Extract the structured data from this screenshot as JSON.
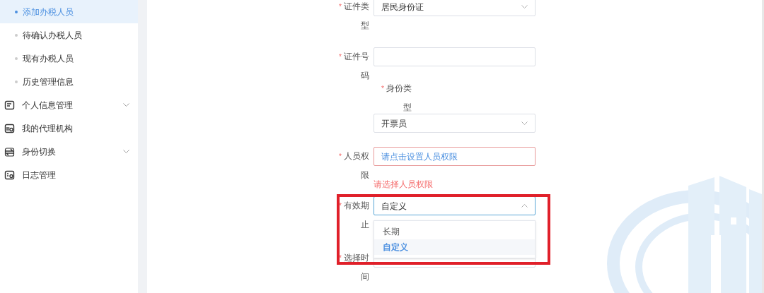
{
  "sidebar": {
    "sub_items": [
      {
        "label": "添加办税人员",
        "selected": true
      },
      {
        "label": "待确认办税人员",
        "selected": false
      },
      {
        "label": "现有办税人员",
        "selected": false
      },
      {
        "label": "历史管理信息",
        "selected": false
      }
    ],
    "menu": [
      {
        "label": "个人信息管理",
        "kind": "list",
        "expandable": true
      },
      {
        "label": "我的代理机构",
        "kind": "agency",
        "expandable": false
      },
      {
        "label": "身份切换",
        "kind": "switch",
        "expandable": true
      },
      {
        "label": "日志管理",
        "kind": "log",
        "expandable": false
      }
    ]
  },
  "form": {
    "fields": [
      {
        "kind": "select",
        "required_mark": "*",
        "label": "证件类型",
        "value": "居民身份证"
      },
      {
        "kind": "input",
        "required_mark": "*",
        "label": "证件号码"
      },
      {
        "kind": "stacked-select",
        "required_mark": "*",
        "label": "身份类型",
        "value": "开票员"
      },
      {
        "kind": "picker",
        "required_mark": "*",
        "label": "人员权限",
        "placeholder": "请点击设置人员权限",
        "invalid": true,
        "error": "请选择人员权限"
      },
      {
        "kind": "select",
        "required_mark": "*",
        "label": "有效期止",
        "value": "自定义",
        "expanded": true,
        "options": [
          {
            "label": "长期",
            "selected": false
          },
          {
            "label": "自定义",
            "selected": true
          }
        ]
      },
      {
        "kind": "input",
        "required_mark": "*",
        "label": "选择时间"
      }
    ]
  }
}
